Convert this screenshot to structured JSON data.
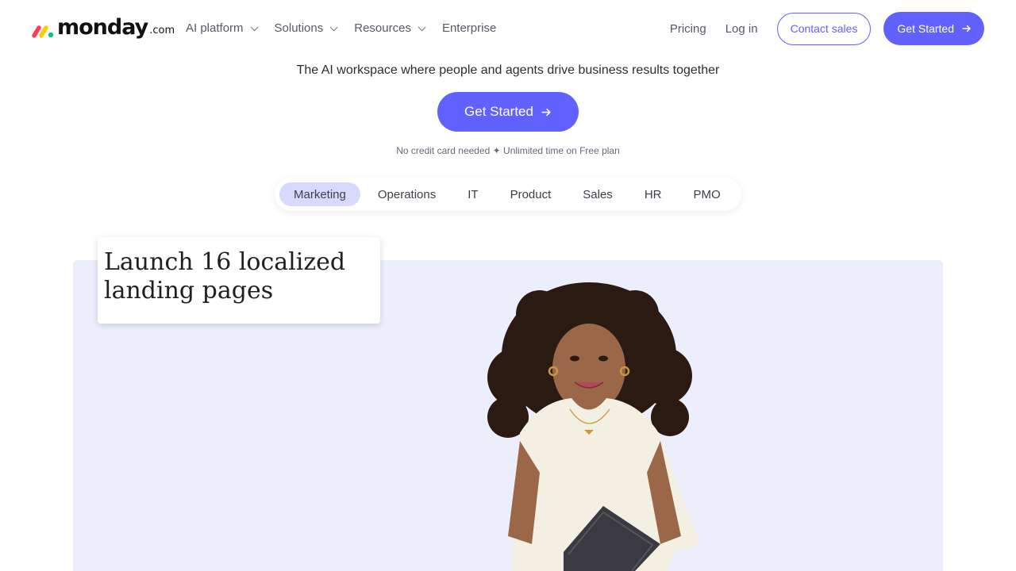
{
  "brand": {
    "name": "monday",
    "suffix": ".com",
    "colors": {
      "red": "#ff3d57",
      "yellow": "#ffcb00",
      "green": "#00ca72",
      "accent": "#6161ff"
    }
  },
  "nav": {
    "items": [
      {
        "label": "AI platform",
        "dropdown": true
      },
      {
        "label": "Solutions",
        "dropdown": true
      },
      {
        "label": "Resources",
        "dropdown": true
      },
      {
        "label": "Enterprise",
        "dropdown": false
      }
    ],
    "pricing": "Pricing",
    "login": "Log in",
    "contact_sales": "Contact sales",
    "get_started": "Get Started"
  },
  "hero": {
    "tagline": "The AI workspace where people and agents drive business results together",
    "cta": "Get Started",
    "note": "No credit card needed ✦ Unlimited time on Free plan"
  },
  "tabs": {
    "items": [
      "Marketing",
      "Operations",
      "IT",
      "Product",
      "Sales",
      "HR",
      "PMO"
    ],
    "active": "Marketing"
  },
  "showcase": {
    "card_title": "Launch 16  localized landing pages",
    "background": "#eceefc"
  }
}
